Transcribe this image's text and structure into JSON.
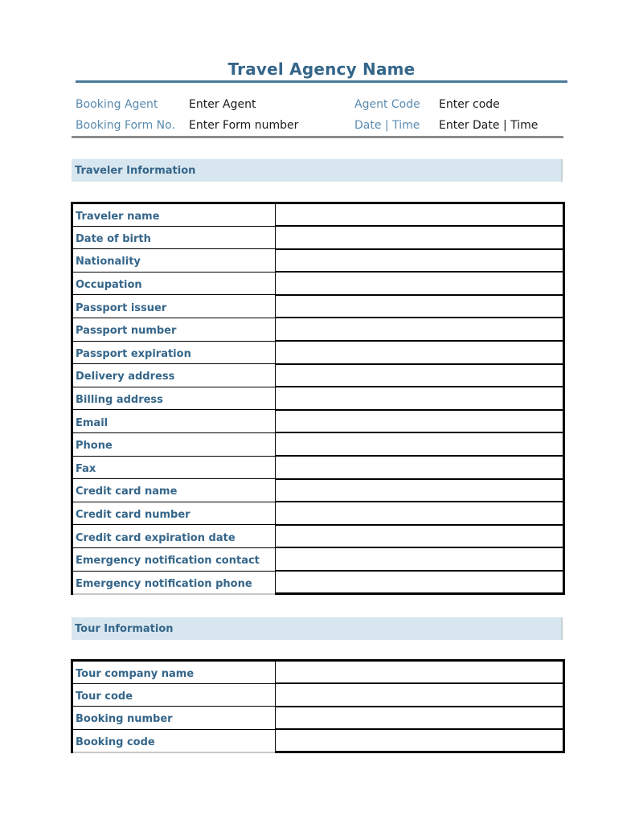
{
  "header": {
    "title": "Travel Agency Name"
  },
  "meta": {
    "rows": [
      {
        "label1": "Booking Agent",
        "value1": "Enter Agent",
        "label2": "Agent Code",
        "value2": "Enter code"
      },
      {
        "label1": "Booking Form No.",
        "value1": "Enter Form number",
        "label2": "Date | Time",
        "value2": "Enter Date | Time"
      }
    ]
  },
  "traveler_section": {
    "title": "Traveler Information",
    "fields": [
      {
        "label": "Traveler name",
        "value": ""
      },
      {
        "label": "Date of birth",
        "value": ""
      },
      {
        "label": "Nationality",
        "value": ""
      },
      {
        "label": "Occupation",
        "value": ""
      },
      {
        "label": "Passport issuer",
        "value": ""
      },
      {
        "label": "Passport number",
        "value": ""
      },
      {
        "label": "Passport expiration",
        "value": ""
      },
      {
        "label": "Delivery address",
        "value": ""
      },
      {
        "label": "Billing address",
        "value": ""
      },
      {
        "label": "Email",
        "value": ""
      },
      {
        "label": "Phone",
        "value": ""
      },
      {
        "label": "Fax",
        "value": ""
      },
      {
        "label": "Credit card name",
        "value": ""
      },
      {
        "label": "Credit card number",
        "value": ""
      },
      {
        "label": "Credit card expiration date",
        "value": ""
      },
      {
        "label": "Emergency notification contact",
        "value": ""
      },
      {
        "label": "Emergency notification phone",
        "value": ""
      }
    ]
  },
  "tour_section": {
    "title": "Tour Information",
    "fields": [
      {
        "label": "Tour company name",
        "value": ""
      },
      {
        "label": "Tour code",
        "value": ""
      },
      {
        "label": "Booking number",
        "value": ""
      },
      {
        "label": "Booking code",
        "value": ""
      }
    ]
  },
  "colors": {
    "accent": "#35668a",
    "label_light": "#5a8bb0",
    "section_fill": "#d7e6ef"
  }
}
